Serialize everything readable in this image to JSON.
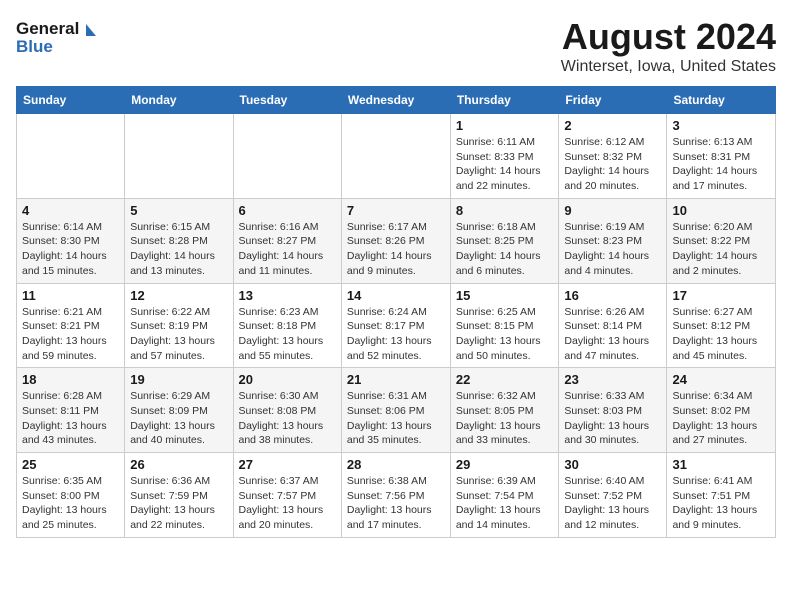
{
  "logo": {
    "line1": "General",
    "line2": "Blue"
  },
  "title": "August 2024",
  "subtitle": "Winterset, Iowa, United States",
  "weekdays": [
    "Sunday",
    "Monday",
    "Tuesday",
    "Wednesday",
    "Thursday",
    "Friday",
    "Saturday"
  ],
  "weeks": [
    [
      {
        "day": "",
        "info": ""
      },
      {
        "day": "",
        "info": ""
      },
      {
        "day": "",
        "info": ""
      },
      {
        "day": "",
        "info": ""
      },
      {
        "day": "1",
        "info": "Sunrise: 6:11 AM\nSunset: 8:33 PM\nDaylight: 14 hours and 22 minutes."
      },
      {
        "day": "2",
        "info": "Sunrise: 6:12 AM\nSunset: 8:32 PM\nDaylight: 14 hours and 20 minutes."
      },
      {
        "day": "3",
        "info": "Sunrise: 6:13 AM\nSunset: 8:31 PM\nDaylight: 14 hours and 17 minutes."
      }
    ],
    [
      {
        "day": "4",
        "info": "Sunrise: 6:14 AM\nSunset: 8:30 PM\nDaylight: 14 hours and 15 minutes."
      },
      {
        "day": "5",
        "info": "Sunrise: 6:15 AM\nSunset: 8:28 PM\nDaylight: 14 hours and 13 minutes."
      },
      {
        "day": "6",
        "info": "Sunrise: 6:16 AM\nSunset: 8:27 PM\nDaylight: 14 hours and 11 minutes."
      },
      {
        "day": "7",
        "info": "Sunrise: 6:17 AM\nSunset: 8:26 PM\nDaylight: 14 hours and 9 minutes."
      },
      {
        "day": "8",
        "info": "Sunrise: 6:18 AM\nSunset: 8:25 PM\nDaylight: 14 hours and 6 minutes."
      },
      {
        "day": "9",
        "info": "Sunrise: 6:19 AM\nSunset: 8:23 PM\nDaylight: 14 hours and 4 minutes."
      },
      {
        "day": "10",
        "info": "Sunrise: 6:20 AM\nSunset: 8:22 PM\nDaylight: 14 hours and 2 minutes."
      }
    ],
    [
      {
        "day": "11",
        "info": "Sunrise: 6:21 AM\nSunset: 8:21 PM\nDaylight: 13 hours and 59 minutes."
      },
      {
        "day": "12",
        "info": "Sunrise: 6:22 AM\nSunset: 8:19 PM\nDaylight: 13 hours and 57 minutes."
      },
      {
        "day": "13",
        "info": "Sunrise: 6:23 AM\nSunset: 8:18 PM\nDaylight: 13 hours and 55 minutes."
      },
      {
        "day": "14",
        "info": "Sunrise: 6:24 AM\nSunset: 8:17 PM\nDaylight: 13 hours and 52 minutes."
      },
      {
        "day": "15",
        "info": "Sunrise: 6:25 AM\nSunset: 8:15 PM\nDaylight: 13 hours and 50 minutes."
      },
      {
        "day": "16",
        "info": "Sunrise: 6:26 AM\nSunset: 8:14 PM\nDaylight: 13 hours and 47 minutes."
      },
      {
        "day": "17",
        "info": "Sunrise: 6:27 AM\nSunset: 8:12 PM\nDaylight: 13 hours and 45 minutes."
      }
    ],
    [
      {
        "day": "18",
        "info": "Sunrise: 6:28 AM\nSunset: 8:11 PM\nDaylight: 13 hours and 43 minutes."
      },
      {
        "day": "19",
        "info": "Sunrise: 6:29 AM\nSunset: 8:09 PM\nDaylight: 13 hours and 40 minutes."
      },
      {
        "day": "20",
        "info": "Sunrise: 6:30 AM\nSunset: 8:08 PM\nDaylight: 13 hours and 38 minutes."
      },
      {
        "day": "21",
        "info": "Sunrise: 6:31 AM\nSunset: 8:06 PM\nDaylight: 13 hours and 35 minutes."
      },
      {
        "day": "22",
        "info": "Sunrise: 6:32 AM\nSunset: 8:05 PM\nDaylight: 13 hours and 33 minutes."
      },
      {
        "day": "23",
        "info": "Sunrise: 6:33 AM\nSunset: 8:03 PM\nDaylight: 13 hours and 30 minutes."
      },
      {
        "day": "24",
        "info": "Sunrise: 6:34 AM\nSunset: 8:02 PM\nDaylight: 13 hours and 27 minutes."
      }
    ],
    [
      {
        "day": "25",
        "info": "Sunrise: 6:35 AM\nSunset: 8:00 PM\nDaylight: 13 hours and 25 minutes."
      },
      {
        "day": "26",
        "info": "Sunrise: 6:36 AM\nSunset: 7:59 PM\nDaylight: 13 hours and 22 minutes."
      },
      {
        "day": "27",
        "info": "Sunrise: 6:37 AM\nSunset: 7:57 PM\nDaylight: 13 hours and 20 minutes."
      },
      {
        "day": "28",
        "info": "Sunrise: 6:38 AM\nSunset: 7:56 PM\nDaylight: 13 hours and 17 minutes."
      },
      {
        "day": "29",
        "info": "Sunrise: 6:39 AM\nSunset: 7:54 PM\nDaylight: 13 hours and 14 minutes."
      },
      {
        "day": "30",
        "info": "Sunrise: 6:40 AM\nSunset: 7:52 PM\nDaylight: 13 hours and 12 minutes."
      },
      {
        "day": "31",
        "info": "Sunrise: 6:41 AM\nSunset: 7:51 PM\nDaylight: 13 hours and 9 minutes."
      }
    ]
  ]
}
